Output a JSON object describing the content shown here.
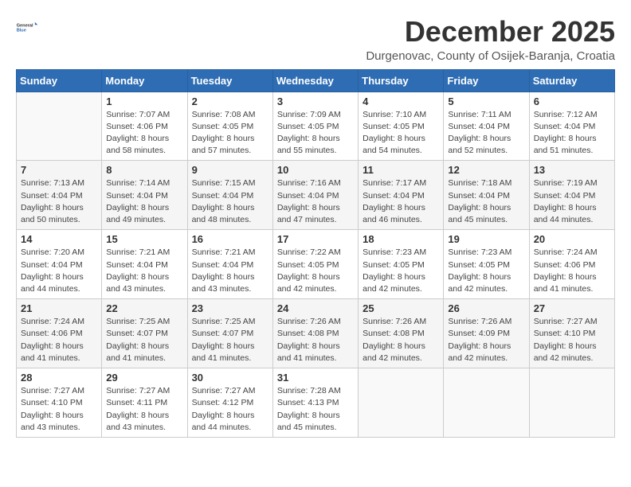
{
  "logo": {
    "general": "General",
    "blue": "Blue"
  },
  "title": "December 2025",
  "location": "Durgenovac, County of Osijek-Baranja, Croatia",
  "days_of_week": [
    "Sunday",
    "Monday",
    "Tuesday",
    "Wednesday",
    "Thursday",
    "Friday",
    "Saturday"
  ],
  "weeks": [
    [
      {
        "day": "",
        "sunrise": "",
        "sunset": "",
        "daylight": ""
      },
      {
        "day": "1",
        "sunrise": "Sunrise: 7:07 AM",
        "sunset": "Sunset: 4:06 PM",
        "daylight": "Daylight: 8 hours and 58 minutes."
      },
      {
        "day": "2",
        "sunrise": "Sunrise: 7:08 AM",
        "sunset": "Sunset: 4:05 PM",
        "daylight": "Daylight: 8 hours and 57 minutes."
      },
      {
        "day": "3",
        "sunrise": "Sunrise: 7:09 AM",
        "sunset": "Sunset: 4:05 PM",
        "daylight": "Daylight: 8 hours and 55 minutes."
      },
      {
        "day": "4",
        "sunrise": "Sunrise: 7:10 AM",
        "sunset": "Sunset: 4:05 PM",
        "daylight": "Daylight: 8 hours and 54 minutes."
      },
      {
        "day": "5",
        "sunrise": "Sunrise: 7:11 AM",
        "sunset": "Sunset: 4:04 PM",
        "daylight": "Daylight: 8 hours and 52 minutes."
      },
      {
        "day": "6",
        "sunrise": "Sunrise: 7:12 AM",
        "sunset": "Sunset: 4:04 PM",
        "daylight": "Daylight: 8 hours and 51 minutes."
      }
    ],
    [
      {
        "day": "7",
        "sunrise": "Sunrise: 7:13 AM",
        "sunset": "Sunset: 4:04 PM",
        "daylight": "Daylight: 8 hours and 50 minutes."
      },
      {
        "day": "8",
        "sunrise": "Sunrise: 7:14 AM",
        "sunset": "Sunset: 4:04 PM",
        "daylight": "Daylight: 8 hours and 49 minutes."
      },
      {
        "day": "9",
        "sunrise": "Sunrise: 7:15 AM",
        "sunset": "Sunset: 4:04 PM",
        "daylight": "Daylight: 8 hours and 48 minutes."
      },
      {
        "day": "10",
        "sunrise": "Sunrise: 7:16 AM",
        "sunset": "Sunset: 4:04 PM",
        "daylight": "Daylight: 8 hours and 47 minutes."
      },
      {
        "day": "11",
        "sunrise": "Sunrise: 7:17 AM",
        "sunset": "Sunset: 4:04 PM",
        "daylight": "Daylight: 8 hours and 46 minutes."
      },
      {
        "day": "12",
        "sunrise": "Sunrise: 7:18 AM",
        "sunset": "Sunset: 4:04 PM",
        "daylight": "Daylight: 8 hours and 45 minutes."
      },
      {
        "day": "13",
        "sunrise": "Sunrise: 7:19 AM",
        "sunset": "Sunset: 4:04 PM",
        "daylight": "Daylight: 8 hours and 44 minutes."
      }
    ],
    [
      {
        "day": "14",
        "sunrise": "Sunrise: 7:20 AM",
        "sunset": "Sunset: 4:04 PM",
        "daylight": "Daylight: 8 hours and 44 minutes."
      },
      {
        "day": "15",
        "sunrise": "Sunrise: 7:21 AM",
        "sunset": "Sunset: 4:04 PM",
        "daylight": "Daylight: 8 hours and 43 minutes."
      },
      {
        "day": "16",
        "sunrise": "Sunrise: 7:21 AM",
        "sunset": "Sunset: 4:04 PM",
        "daylight": "Daylight: 8 hours and 43 minutes."
      },
      {
        "day": "17",
        "sunrise": "Sunrise: 7:22 AM",
        "sunset": "Sunset: 4:05 PM",
        "daylight": "Daylight: 8 hours and 42 minutes."
      },
      {
        "day": "18",
        "sunrise": "Sunrise: 7:23 AM",
        "sunset": "Sunset: 4:05 PM",
        "daylight": "Daylight: 8 hours and 42 minutes."
      },
      {
        "day": "19",
        "sunrise": "Sunrise: 7:23 AM",
        "sunset": "Sunset: 4:05 PM",
        "daylight": "Daylight: 8 hours and 42 minutes."
      },
      {
        "day": "20",
        "sunrise": "Sunrise: 7:24 AM",
        "sunset": "Sunset: 4:06 PM",
        "daylight": "Daylight: 8 hours and 41 minutes."
      }
    ],
    [
      {
        "day": "21",
        "sunrise": "Sunrise: 7:24 AM",
        "sunset": "Sunset: 4:06 PM",
        "daylight": "Daylight: 8 hours and 41 minutes."
      },
      {
        "day": "22",
        "sunrise": "Sunrise: 7:25 AM",
        "sunset": "Sunset: 4:07 PM",
        "daylight": "Daylight: 8 hours and 41 minutes."
      },
      {
        "day": "23",
        "sunrise": "Sunrise: 7:25 AM",
        "sunset": "Sunset: 4:07 PM",
        "daylight": "Daylight: 8 hours and 41 minutes."
      },
      {
        "day": "24",
        "sunrise": "Sunrise: 7:26 AM",
        "sunset": "Sunset: 4:08 PM",
        "daylight": "Daylight: 8 hours and 41 minutes."
      },
      {
        "day": "25",
        "sunrise": "Sunrise: 7:26 AM",
        "sunset": "Sunset: 4:08 PM",
        "daylight": "Daylight: 8 hours and 42 minutes."
      },
      {
        "day": "26",
        "sunrise": "Sunrise: 7:26 AM",
        "sunset": "Sunset: 4:09 PM",
        "daylight": "Daylight: 8 hours and 42 minutes."
      },
      {
        "day": "27",
        "sunrise": "Sunrise: 7:27 AM",
        "sunset": "Sunset: 4:10 PM",
        "daylight": "Daylight: 8 hours and 42 minutes."
      }
    ],
    [
      {
        "day": "28",
        "sunrise": "Sunrise: 7:27 AM",
        "sunset": "Sunset: 4:10 PM",
        "daylight": "Daylight: 8 hours and 43 minutes."
      },
      {
        "day": "29",
        "sunrise": "Sunrise: 7:27 AM",
        "sunset": "Sunset: 4:11 PM",
        "daylight": "Daylight: 8 hours and 43 minutes."
      },
      {
        "day": "30",
        "sunrise": "Sunrise: 7:27 AM",
        "sunset": "Sunset: 4:12 PM",
        "daylight": "Daylight: 8 hours and 44 minutes."
      },
      {
        "day": "31",
        "sunrise": "Sunrise: 7:28 AM",
        "sunset": "Sunset: 4:13 PM",
        "daylight": "Daylight: 8 hours and 45 minutes."
      },
      {
        "day": "",
        "sunrise": "",
        "sunset": "",
        "daylight": ""
      },
      {
        "day": "",
        "sunrise": "",
        "sunset": "",
        "daylight": ""
      },
      {
        "day": "",
        "sunrise": "",
        "sunset": "",
        "daylight": ""
      }
    ]
  ]
}
